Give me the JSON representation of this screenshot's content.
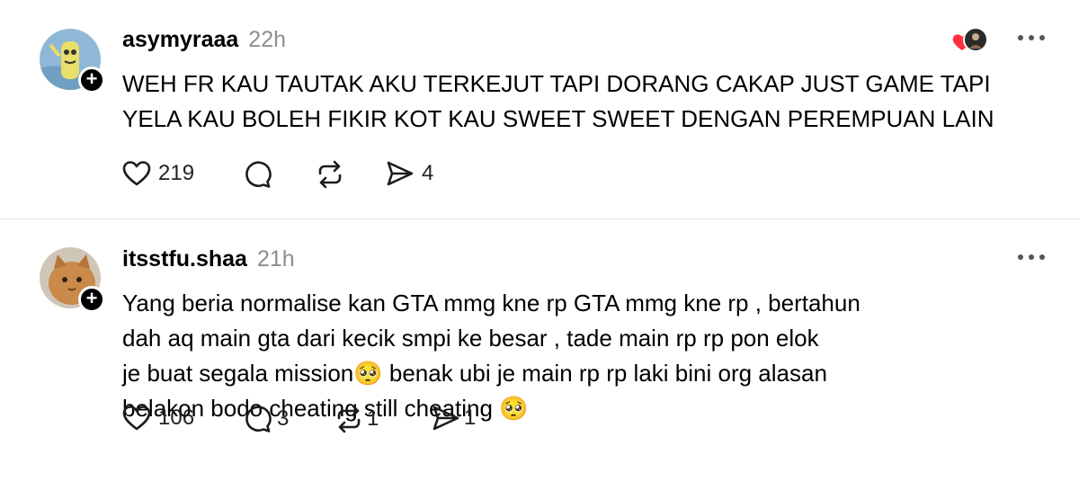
{
  "posts": [
    {
      "username": "asymyraaa",
      "time": "22h",
      "text": "WEH FR KAU TAUTAK AKU TERKEJUT TAPI DORANG CAKAP JUST GAME TAPI\nYELA KAU BOLEH FIKIR KOT KAU SWEET SWEET DENGAN PEREMPUAN LAIN",
      "likes": "219",
      "replies": "",
      "reposts": "",
      "shares": "4"
    },
    {
      "username": "itsstfu.shaa",
      "time": "21h",
      "text": "Yang beria normalise kan GTA mmg kne rp GTA mmg kne rp , bertahun\ndah aq main gta dari kecik smpi ke besar , tade main rp rp pon elok\nje buat segala mission🥺 benak ubi je main rp rp laki bini org alasan\nbelakon bodo cheating still cheating 🥺",
      "likes": "106",
      "replies": "3",
      "reposts": "1",
      "shares": "1"
    }
  ],
  "icons": {
    "like": "heart-outline-icon",
    "reply": "speech-bubble-icon",
    "repost": "repost-arrows-icon",
    "share": "paper-plane-icon",
    "more": "more-horizontal-icon"
  }
}
